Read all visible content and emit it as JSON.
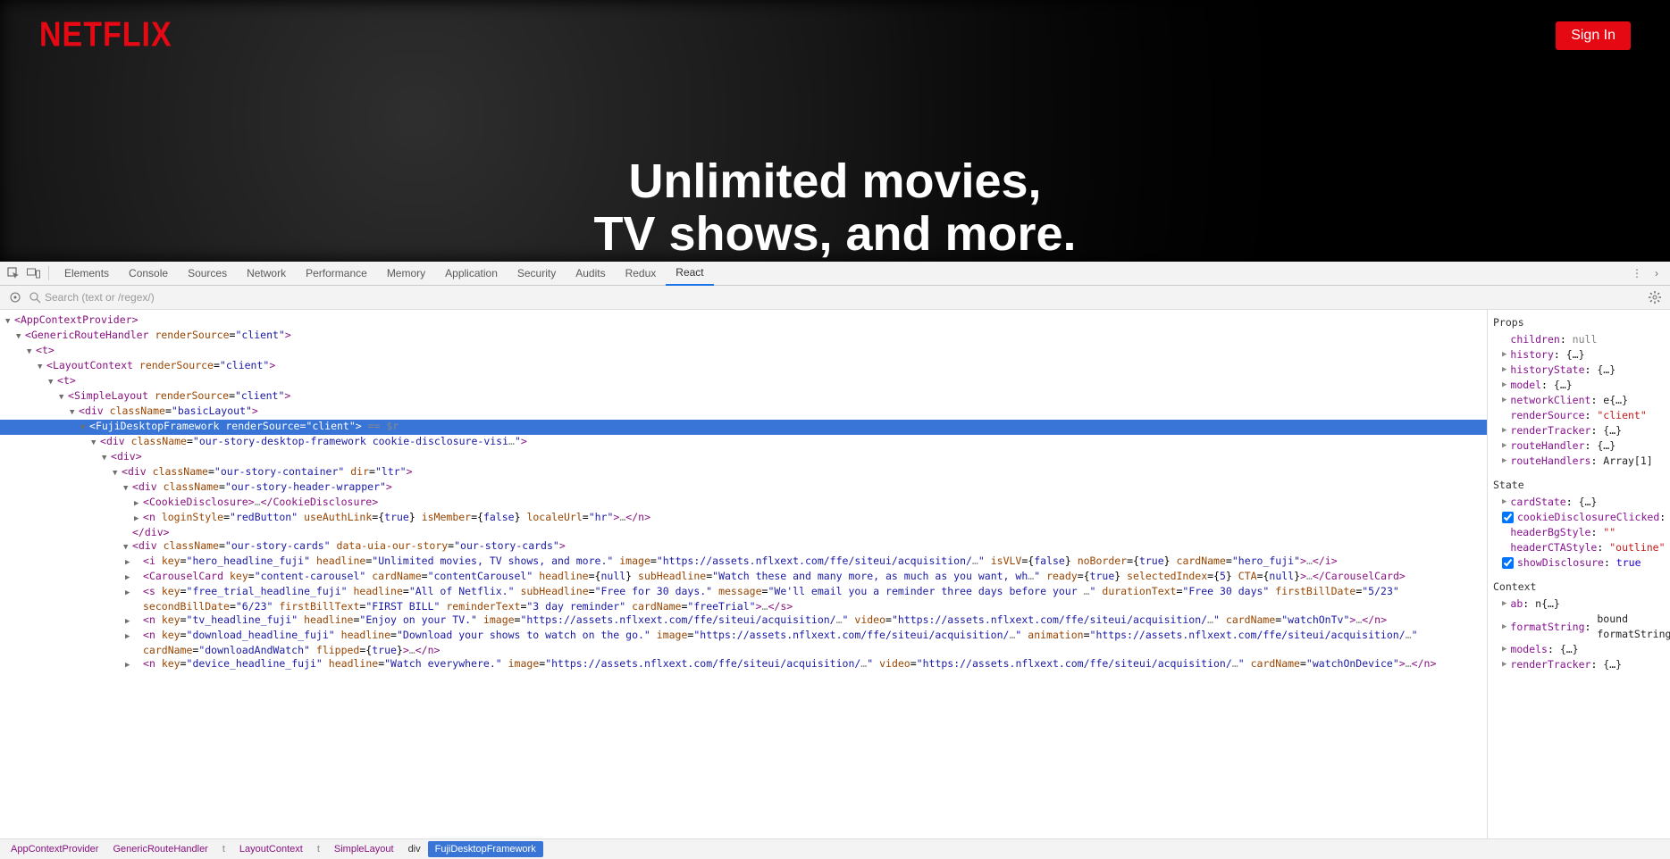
{
  "page": {
    "logo": "NETFLIX",
    "signIn": "Sign In",
    "heroLine1": "Unlimited movies,",
    "heroLine2": "TV shows, and more."
  },
  "devtools": {
    "tabs": [
      "Elements",
      "Console",
      "Sources",
      "Network",
      "Performance",
      "Memory",
      "Application",
      "Security",
      "Audits",
      "Redux",
      "React"
    ],
    "activeTab": "React",
    "searchPlaceholder": "Search (text or /regex/)"
  },
  "treeLines": [
    {
      "indent": 0,
      "caret": "open",
      "raw": "<AppContextProvider>"
    },
    {
      "indent": 1,
      "caret": "open",
      "raw": "<GenericRouteHandler renderSource=\"client\">"
    },
    {
      "indent": 2,
      "caret": "open",
      "raw": "<t>"
    },
    {
      "indent": 3,
      "caret": "open",
      "raw": "<LayoutContext renderSource=\"client\">"
    },
    {
      "indent": 4,
      "caret": "open",
      "raw": "<t>"
    },
    {
      "indent": 5,
      "caret": "open",
      "raw": "<SimpleLayout renderSource=\"client\">"
    },
    {
      "indent": 6,
      "caret": "open",
      "raw": "<div className=\"basicLayout\">"
    },
    {
      "indent": 7,
      "caret": "open",
      "selected": true,
      "raw": "<FujiDesktopFramework renderSource=\"client\">",
      "suffix": " == $r"
    },
    {
      "indent": 8,
      "caret": "open",
      "raw": "<div className=\"our-story-desktop-framework cookie-disclosure-visi…\">"
    },
    {
      "indent": 9,
      "caret": "open",
      "raw": "<div>"
    },
    {
      "indent": 10,
      "caret": "open",
      "raw": "<div className=\"our-story-container\" dir=\"ltr\">"
    },
    {
      "indent": 11,
      "caret": "open",
      "raw": "<div className=\"our-story-header-wrapper\">"
    },
    {
      "indent": 12,
      "caret": "closed",
      "raw": "<CookieDisclosure>…</CookieDisclosure>"
    },
    {
      "indent": 12,
      "caret": "closed",
      "raw": "<n loginStyle=\"redButton\" useAuthLink={true} isMember={false} localeUrl=\"hr\">…</n>"
    },
    {
      "indent": 11,
      "caret": "none",
      "raw": "</div>"
    },
    {
      "indent": 11,
      "caret": "open",
      "raw": "<div className=\"our-story-cards\" data-uia-our-story=\"our-story-cards\">"
    },
    {
      "indent": 12,
      "caret": "closed",
      "wrap": true,
      "raw": "<i key=\"hero_headline_fuji\" headline=\"Unlimited movies, TV shows, and more.\" image=\"https://assets.nflxext.com/ffe/siteui/acquisition/…\" isVLV={false} noBorder={true} cardName=\"hero_fuji\">…</i>"
    },
    {
      "indent": 12,
      "caret": "closed",
      "wrap": true,
      "raw": "<CarouselCard key=\"content-carousel\" cardName=\"contentCarousel\" headline={null} subHeadline=\"Watch these and many more, as much as you want, wh…\" ready={true} selectedIndex={5} CTA={null}>…</CarouselCard>"
    },
    {
      "indent": 12,
      "caret": "closed",
      "wrap": true,
      "raw": "<s key=\"free_trial_headline_fuji\" headline=\"All of Netflix.\" subHeadline=\"Free for 30 days.\" message=\"We'll email you a reminder three days before your …\" durationText=\"Free 30 days\" firstBillDate=\"5/23\" secondBillDate=\"6/23\" firstBillText=\"FIRST BILL\" reminderText=\"3 day reminder\" cardName=\"freeTrial\">…</s>"
    },
    {
      "indent": 12,
      "caret": "closed",
      "wrap": true,
      "raw": "<n key=\"tv_headline_fuji\" headline=\"Enjoy on your TV.\" image=\"https://assets.nflxext.com/ffe/siteui/acquisition/…\" video=\"https://assets.nflxext.com/ffe/siteui/acquisition/…\" cardName=\"watchOnTv\">…</n>"
    },
    {
      "indent": 12,
      "caret": "closed",
      "wrap": true,
      "raw": "<n key=\"download_headline_fuji\" headline=\"Download your shows to watch on the go.\" image=\"https://assets.nflxext.com/ffe/siteui/acquisition/…\" animation=\"https://assets.nflxext.com/ffe/siteui/acquisition/…\" cardName=\"downloadAndWatch\" flipped={true}>…</n>"
    },
    {
      "indent": 12,
      "caret": "closed",
      "wrap": true,
      "raw": "<n key=\"device_headline_fuji\" headline=\"Watch everywhere.\" image=\"https://assets.nflxext.com/ffe/siteui/acquisition/…\" video=\"https://assets.nflxext.com/ffe/siteui/acquisition/…\" cardName=\"watchOnDevice\">…</n>"
    }
  ],
  "sidebar": {
    "propsHead": "Props",
    "props": [
      {
        "k": "children",
        "v": "null",
        "t": "null"
      },
      {
        "k": "history",
        "v": "{…}",
        "t": "obj",
        "tri": true
      },
      {
        "k": "historyState",
        "v": "{…}",
        "t": "obj",
        "tri": true
      },
      {
        "k": "model",
        "v": "{…}",
        "t": "obj",
        "tri": true
      },
      {
        "k": "networkClient",
        "v": "e{…}",
        "t": "fn",
        "tri": true
      },
      {
        "k": "renderSource",
        "v": "\"client\"",
        "t": "str"
      },
      {
        "k": "renderTracker",
        "v": "{…}",
        "t": "obj",
        "tri": true
      },
      {
        "k": "routeHandler",
        "v": "{…}",
        "t": "obj",
        "tri": true
      },
      {
        "k": "routeHandlers",
        "v": "Array[1]",
        "t": "obj",
        "tri": true
      }
    ],
    "stateHead": "State",
    "state": [
      {
        "k": "cardState",
        "v": "{…}",
        "t": "obj",
        "tri": true
      },
      {
        "k": "cookieDisclosureClicked",
        "v": "true",
        "t": "bool",
        "ck": true
      },
      {
        "k": "headerBgStyle",
        "v": "\"\"",
        "t": "str"
      },
      {
        "k": "headerCTAStyle",
        "v": "\"outline\"",
        "t": "str"
      },
      {
        "k": "showDisclosure",
        "v": "true",
        "t": "bool",
        "ck": true
      }
    ],
    "contextHead": "Context",
    "context": [
      {
        "k": "ab",
        "v": "n{…}",
        "t": "fn",
        "tri": true
      },
      {
        "k": "formatString",
        "v": "bound formatString",
        "t": "fn",
        "tri": true
      },
      {
        "k": "models",
        "v": "{…}",
        "t": "obj",
        "tri": true
      },
      {
        "k": "renderTracker",
        "v": "{…}",
        "t": "obj",
        "tri": true
      }
    ]
  },
  "breadcrumb": [
    {
      "label": "AppContextProvider",
      "cls": "bc-item"
    },
    {
      "label": "GenericRouteHandler",
      "cls": "bc-item"
    },
    {
      "label": "t",
      "cls": "bc-item dim"
    },
    {
      "label": "LayoutContext",
      "cls": "bc-item"
    },
    {
      "label": "t",
      "cls": "bc-item dim"
    },
    {
      "label": "SimpleLayout",
      "cls": "bc-item"
    },
    {
      "label": "div",
      "cls": "bc-item plain"
    },
    {
      "label": "FujiDesktopFramework",
      "cls": "bc-item active"
    }
  ]
}
